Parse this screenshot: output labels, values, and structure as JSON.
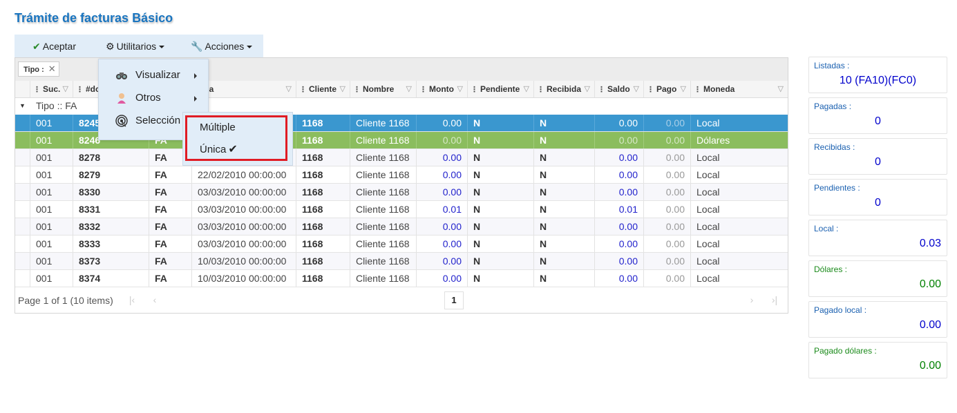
{
  "title": "Trámite de facturas Básico",
  "toolbar": {
    "aceptar": "Aceptar",
    "utilitarios": "Utilitarios",
    "acciones": "Acciones"
  },
  "group_chip": {
    "label": "Tipo :"
  },
  "columns": [
    "Suc.",
    "#do",
    "echa",
    "Cliente",
    "Nombre",
    "Monto",
    "Pendiente",
    "Recibida",
    "Saldo",
    "Pago",
    "Moneda"
  ],
  "group_row": "Tipo :: FA",
  "rows": [
    {
      "suc": "001",
      "doc": "8245",
      "tipo": "",
      "fecha": "",
      "cliente": "1168",
      "nombre": "Cliente 1168",
      "monto": "0.00",
      "pendiente": "N",
      "recibida": "N",
      "saldo": "0.00",
      "pago": "0.00",
      "moneda": "Local"
    },
    {
      "suc": "001",
      "doc": "8246",
      "tipo": "FA",
      "fecha": "",
      "cliente": "1168",
      "nombre": "Cliente 1168",
      "monto": "0.00",
      "pendiente": "N",
      "recibida": "N",
      "saldo": "0.00",
      "pago": "0.00",
      "moneda": "Dólares"
    },
    {
      "suc": "001",
      "doc": "8278",
      "tipo": "FA",
      "fecha": "",
      "cliente": "1168",
      "nombre": "Cliente 1168",
      "monto": "0.00",
      "pendiente": "N",
      "recibida": "N",
      "saldo": "0.00",
      "pago": "0.00",
      "moneda": "Local"
    },
    {
      "suc": "001",
      "doc": "8279",
      "tipo": "FA",
      "fecha": "22/02/2010 00:00:00",
      "cliente": "1168",
      "nombre": "Cliente 1168",
      "monto": "0.00",
      "pendiente": "N",
      "recibida": "N",
      "saldo": "0.00",
      "pago": "0.00",
      "moneda": "Local"
    },
    {
      "suc": "001",
      "doc": "8330",
      "tipo": "FA",
      "fecha": "03/03/2010 00:00:00",
      "cliente": "1168",
      "nombre": "Cliente 1168",
      "monto": "0.00",
      "pendiente": "N",
      "recibida": "N",
      "saldo": "0.00",
      "pago": "0.00",
      "moneda": "Local"
    },
    {
      "suc": "001",
      "doc": "8331",
      "tipo": "FA",
      "fecha": "03/03/2010 00:00:00",
      "cliente": "1168",
      "nombre": "Cliente 1168",
      "monto": "0.01",
      "pendiente": "N",
      "recibida": "N",
      "saldo": "0.01",
      "pago": "0.00",
      "moneda": "Local"
    },
    {
      "suc": "001",
      "doc": "8332",
      "tipo": "FA",
      "fecha": "03/03/2010 00:00:00",
      "cliente": "1168",
      "nombre": "Cliente 1168",
      "monto": "0.00",
      "pendiente": "N",
      "recibida": "N",
      "saldo": "0.00",
      "pago": "0.00",
      "moneda": "Local"
    },
    {
      "suc": "001",
      "doc": "8333",
      "tipo": "FA",
      "fecha": "03/03/2010 00:00:00",
      "cliente": "1168",
      "nombre": "Cliente 1168",
      "monto": "0.00",
      "pendiente": "N",
      "recibida": "N",
      "saldo": "0.00",
      "pago": "0.00",
      "moneda": "Local"
    },
    {
      "suc": "001",
      "doc": "8373",
      "tipo": "FA",
      "fecha": "10/03/2010 00:00:00",
      "cliente": "1168",
      "nombre": "Cliente 1168",
      "monto": "0.00",
      "pendiente": "N",
      "recibida": "N",
      "saldo": "0.00",
      "pago": "0.00",
      "moneda": "Local"
    },
    {
      "suc": "001",
      "doc": "8374",
      "tipo": "FA",
      "fecha": "10/03/2010 00:00:00",
      "cliente": "1168",
      "nombre": "Cliente 1168",
      "monto": "0.00",
      "pendiente": "N",
      "recibida": "N",
      "saldo": "0.00",
      "pago": "0.00",
      "moneda": "Local"
    }
  ],
  "pager": {
    "info": "Page 1 of 1 (10 items)",
    "page": "1"
  },
  "menu_utilitarios": {
    "visualizar": "Visualizar",
    "otros": "Otros",
    "seleccion": "Selección"
  },
  "menu_seleccion": {
    "multiple": "Múltiple",
    "unica": "Única",
    "unica_checked": true
  },
  "summary": [
    {
      "label": "Listadas :",
      "value": "10 (FA10)(FC0)"
    },
    {
      "label": "Pagadas :",
      "value": "0"
    },
    {
      "label": "Recibidas :",
      "value": "0"
    },
    {
      "label": "Pendientes :",
      "value": "0"
    },
    {
      "label": "Local :",
      "value": "0.03"
    },
    {
      "label": "Dólares :",
      "value": "0.00"
    },
    {
      "label": "Pagado local :",
      "value": "0.00"
    },
    {
      "label": "Pagado dólares :",
      "value": "0.00"
    }
  ],
  "colors": {
    "title": "#1a75c0",
    "selected_row": "#3a97cf",
    "green_row": "#8bbd5e",
    "highlight_box": "#e01b24",
    "blue_value": "#0000cc",
    "green_value": "#008000"
  }
}
